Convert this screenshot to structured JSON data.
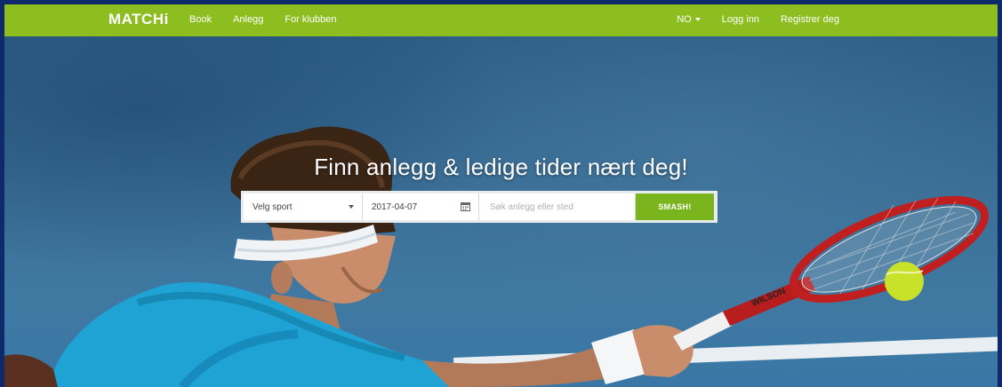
{
  "navbar": {
    "brand": "MATCHi",
    "links": [
      "Book",
      "Anlegg",
      "For klubben"
    ],
    "language": "NO",
    "login": "Logg inn",
    "register": "Registrer deg"
  },
  "hero": {
    "title": "Finn anlegg & ledige tider nært deg!",
    "sport_select": "Velg sport",
    "date_value": "2017-04-07",
    "search_placeholder": "Søk anlegg eller sted",
    "submit_label": "SMASH!",
    "racket_brand": "WILSON"
  },
  "colors": {
    "nav_green": "#8dbe1f",
    "button_green": "#7ab51d",
    "frame_border": "#0e2a6a"
  }
}
